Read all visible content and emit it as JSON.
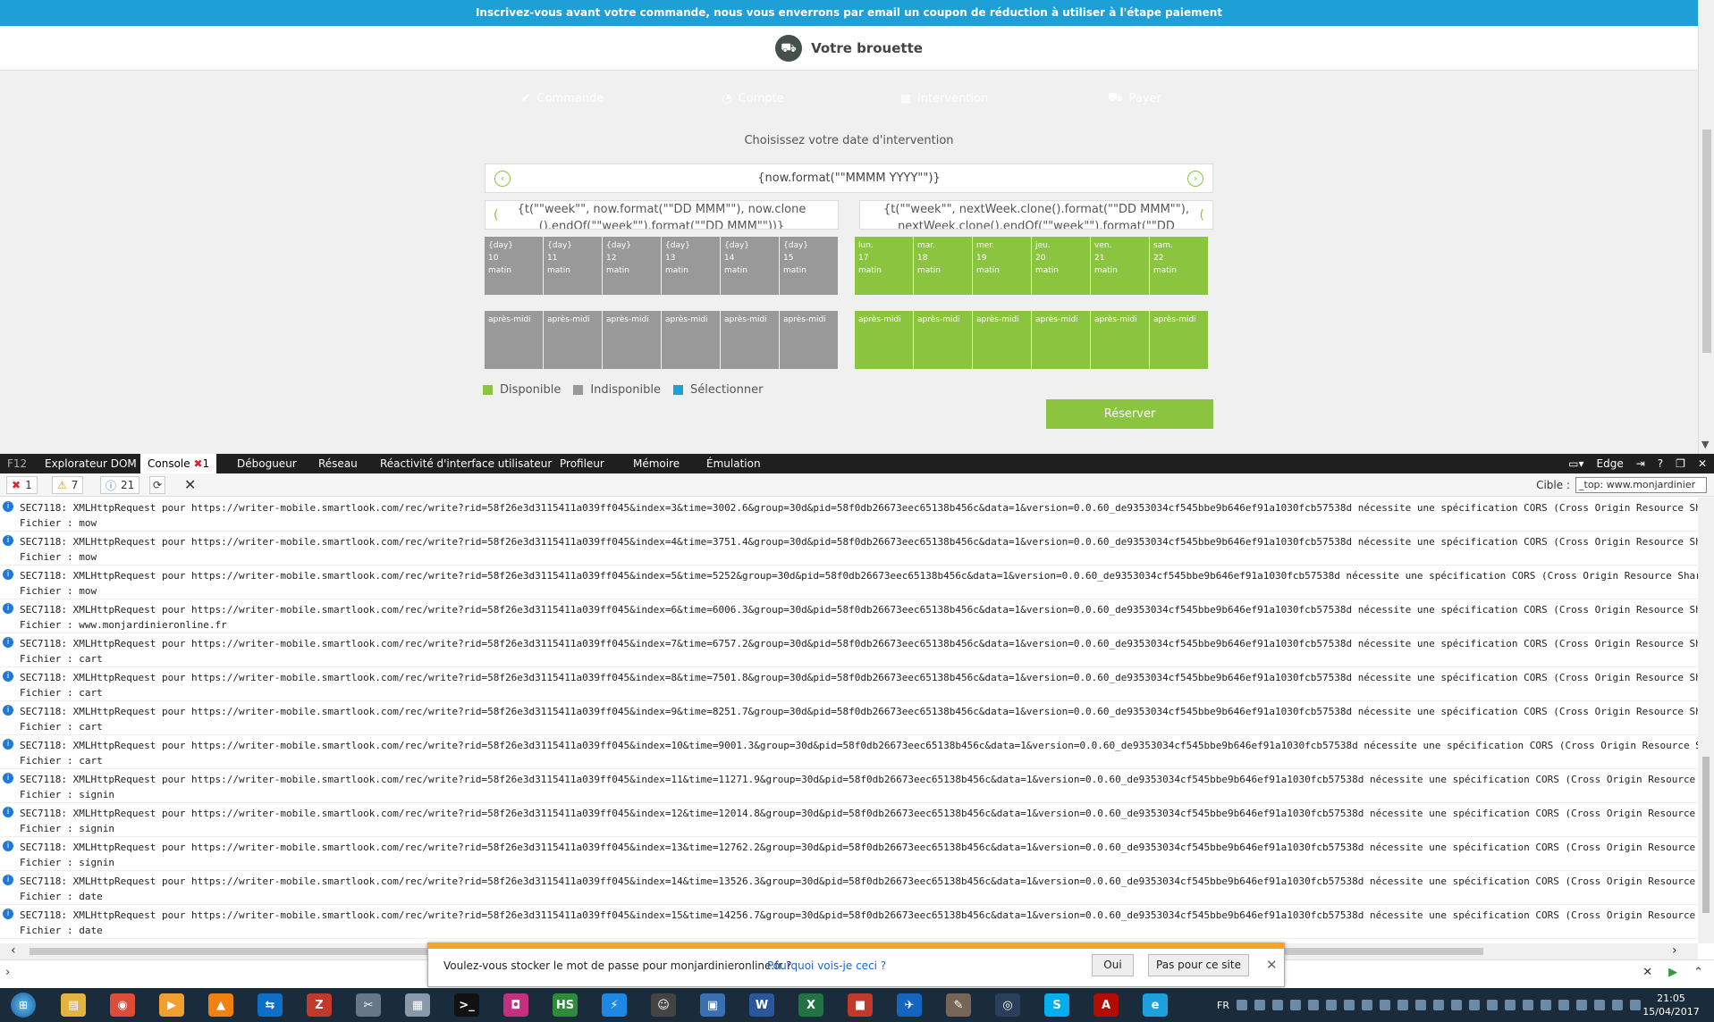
{
  "banner": {
    "text": "Inscrivez-vous avant votre commande, nous vous enverrons par email un coupon de réduction à utiliser à l'étape paiement"
  },
  "header": {
    "title": "Votre brouette"
  },
  "steps": [
    {
      "label": "Commande",
      "icon": "check-icon",
      "glyph": "✔",
      "state": "done"
    },
    {
      "label": "Compte",
      "icon": "user-icon",
      "glyph": "◔",
      "state": "done"
    },
    {
      "label": "Intervention",
      "icon": "calendar-icon",
      "glyph": "▦",
      "state": "done"
    },
    {
      "label": "Payer",
      "icon": "cart-icon",
      "glyph": "⛟",
      "state": "active"
    }
  ],
  "calendar": {
    "title": "Choisissez votre date d'intervention",
    "month_label": "{now.format(\"\"MMMM YYYY\"\")}",
    "week1": {
      "label": "{t(\"\"week\"\", now.format(\"\"DD MMM\"\"), now.clone ().endOf(\"\"week\"\").format(\"\"DD MMM\"\"))}"
    },
    "week2": {
      "label": "{t(\"\"week\"\", nextWeek.clone().format(\"\"DD MMM\"\"), nextWeek.clone().endOf(\"\"week\"\").format(\"\"DD MMM\"\"))}"
    },
    "week1_days": [
      {
        "name": "{day}",
        "num": "10",
        "morning": "matin",
        "afternoon": "après-midi"
      },
      {
        "name": "{day}",
        "num": "11",
        "morning": "matin",
        "afternoon": "après-midi"
      },
      {
        "name": "{day}",
        "num": "12",
        "morning": "matin",
        "afternoon": "après-midi"
      },
      {
        "name": "{day}",
        "num": "13",
        "morning": "matin",
        "afternoon": "après-midi"
      },
      {
        "name": "{day}",
        "num": "14",
        "morning": "matin",
        "afternoon": "après-midi"
      },
      {
        "name": "{day}",
        "num": "15",
        "morning": "matin",
        "afternoon": "après-midi"
      }
    ],
    "week2_days": [
      {
        "name": "lun.",
        "num": "17",
        "morning": "matin",
        "afternoon": "après-midi"
      },
      {
        "name": "mar.",
        "num": "18",
        "morning": "matin",
        "afternoon": "après-midi"
      },
      {
        "name": "mer.",
        "num": "19",
        "morning": "matin",
        "afternoon": "après-midi"
      },
      {
        "name": "jeu.",
        "num": "20",
        "morning": "matin",
        "afternoon": "après-midi"
      },
      {
        "name": "ven.",
        "num": "21",
        "morning": "matin",
        "afternoon": "après-midi"
      },
      {
        "name": "sam.",
        "num": "22",
        "morning": "matin",
        "afternoon": "après-midi"
      }
    ],
    "legend": [
      {
        "label": "Disponible",
        "color": "#8bc540"
      },
      {
        "label": "Indisponible",
        "color": "#999999"
      },
      {
        "label": "Sélectionner",
        "color": "#1e9fd6"
      }
    ],
    "reserve_label": "Réserver"
  },
  "devtools": {
    "tabs": [
      {
        "label": "F12",
        "active": false
      },
      {
        "label": "Explorateur DOM",
        "active": false
      },
      {
        "label": "Console",
        "active": true,
        "badge": "1"
      },
      {
        "label": "Débogueur",
        "active": false
      },
      {
        "label": "Réseau",
        "active": false
      },
      {
        "label": "Réactivité d'interface utilisateur",
        "active": false
      },
      {
        "label": "Profileur",
        "active": false
      },
      {
        "label": "Mémoire",
        "active": false
      },
      {
        "label": "Émulation",
        "active": false
      }
    ],
    "mode_label": "Edge",
    "counts": {
      "errors": "1",
      "warnings": "7",
      "info": "21"
    },
    "target_label": "Cible :",
    "target_value": "_top: www.monjardinier",
    "logs": [
      {
        "msg": "SEC7118: XMLHttpRequest pour https://writer-mobile.smartlook.com/rec/write?rid=58f26e3d3115411a039ff045&index=3&time=3002.6&group=30d&pid=58f0db26673eec65138b456c&data=1&version=0.0.60_de9353034cf545bbe9b646ef91a1030fcb57538d nécessite une spécification CORS (Cross Origin Resource Sha",
        "file": "Fichier : mow"
      },
      {
        "msg": "SEC7118: XMLHttpRequest pour https://writer-mobile.smartlook.com/rec/write?rid=58f26e3d3115411a039ff045&index=4&time=3751.4&group=30d&pid=58f0db26673eec65138b456c&data=1&version=0.0.60_de9353034cf545bbe9b646ef91a1030fcb57538d nécessite une spécification CORS (Cross Origin Resource Sha",
        "file": "Fichier : mow"
      },
      {
        "msg": "SEC7118: XMLHttpRequest pour https://writer-mobile.smartlook.com/rec/write?rid=58f26e3d3115411a039ff045&index=5&time=5252&group=30d&pid=58f0db26673eec65138b456c&data=1&version=0.0.60_de9353034cf545bbe9b646ef91a1030fcb57538d nécessite une spécification CORS (Cross Origin Resource Shar",
        "file": "Fichier : mow"
      },
      {
        "msg": "SEC7118: XMLHttpRequest pour https://writer-mobile.smartlook.com/rec/write?rid=58f26e3d3115411a039ff045&index=6&time=6006.3&group=30d&pid=58f0db26673eec65138b456c&data=1&version=0.0.60_de9353034cf545bbe9b646ef91a1030fcb57538d nécessite une spécification CORS (Cross Origin Resource Sha",
        "file": "Fichier : www.monjardinieronline.fr"
      },
      {
        "msg": "SEC7118: XMLHttpRequest pour https://writer-mobile.smartlook.com/rec/write?rid=58f26e3d3115411a039ff045&index=7&time=6757.2&group=30d&pid=58f0db26673eec65138b456c&data=1&version=0.0.60_de9353034cf545bbe9b646ef91a1030fcb57538d nécessite une spécification CORS (Cross Origin Resource Sha",
        "file": "Fichier : cart"
      },
      {
        "msg": "SEC7118: XMLHttpRequest pour https://writer-mobile.smartlook.com/rec/write?rid=58f26e3d3115411a039ff045&index=8&time=7501.8&group=30d&pid=58f0db26673eec65138b456c&data=1&version=0.0.60_de9353034cf545bbe9b646ef91a1030fcb57538d nécessite une spécification CORS (Cross Origin Resource Sha",
        "file": "Fichier : cart"
      },
      {
        "msg": "SEC7118: XMLHttpRequest pour https://writer-mobile.smartlook.com/rec/write?rid=58f26e3d3115411a039ff045&index=9&time=8251.7&group=30d&pid=58f0db26673eec65138b456c&data=1&version=0.0.60_de9353034cf545bbe9b646ef91a1030fcb57538d nécessite une spécification CORS (Cross Origin Resource Sha",
        "file": "Fichier : cart"
      },
      {
        "msg": "SEC7118: XMLHttpRequest pour https://writer-mobile.smartlook.com/rec/write?rid=58f26e3d3115411a039ff045&index=10&time=9001.3&group=30d&pid=58f0db26673eec65138b456c&data=1&version=0.0.60_de9353034cf545bbe9b646ef91a1030fcb57538d nécessite une spécification CORS (Cross Origin Resource S",
        "file": "Fichier : cart"
      },
      {
        "msg": "SEC7118: XMLHttpRequest pour https://writer-mobile.smartlook.com/rec/write?rid=58f26e3d3115411a039ff045&index=11&time=11271.9&group=30d&pid=58f0db26673eec65138b456c&data=1&version=0.0.60_de9353034cf545bbe9b646ef91a1030fcb57538d nécessite une spécification CORS (Cross Origin Resource",
        "file": "Fichier : signin"
      },
      {
        "msg": "SEC7118: XMLHttpRequest pour https://writer-mobile.smartlook.com/rec/write?rid=58f26e3d3115411a039ff045&index=12&time=12014.8&group=30d&pid=58f0db26673eec65138b456c&data=1&version=0.0.60_de9353034cf545bbe9b646ef91a1030fcb57538d nécessite une spécification CORS (Cross Origin Resource",
        "file": "Fichier : signin"
      },
      {
        "msg": "SEC7118: XMLHttpRequest pour https://writer-mobile.smartlook.com/rec/write?rid=58f26e3d3115411a039ff045&index=13&time=12762.2&group=30d&pid=58f0db26673eec65138b456c&data=1&version=0.0.60_de9353034cf545bbe9b646ef91a1030fcb57538d nécessite une spécification CORS (Cross Origin Resource",
        "file": "Fichier : signin"
      },
      {
        "msg": "SEC7118: XMLHttpRequest pour https://writer-mobile.smartlook.com/rec/write?rid=58f26e3d3115411a039ff045&index=14&time=13526.3&group=30d&pid=58f0db26673eec65138b456c&data=1&version=0.0.60_de9353034cf545bbe9b646ef91a1030fcb57538d nécessite une spécification CORS (Cross Origin Resource S",
        "file": "Fichier : date"
      },
      {
        "msg": "SEC7118: XMLHttpRequest pour https://writer-mobile.smartlook.com/rec/write?rid=58f26e3d3115411a039ff045&index=15&time=14256.7&group=30d&pid=58f0db26673eec65138b456c&data=1&version=0.0.60_de9353034cf545bbe9b646ef91a1030fcb57538d nécessite une spécification CORS (Cross Origin Resource S",
        "file": "Fichier : date"
      }
    ]
  },
  "password_prompt": {
    "question": "Voulez-vous stocker le mot de passe pour monjardinieronline.fr ?",
    "why_link": "Pourquoi vois-je ceci ?",
    "yes_label": "Oui",
    "no_label": "Pas pour ce site"
  },
  "taskbar": {
    "apps": [
      {
        "name": "explorer-icon",
        "color": "#e3b341",
        "glyph": "▤"
      },
      {
        "name": "chrome-icon",
        "color": "#dd4b39",
        "glyph": "◉"
      },
      {
        "name": "media-player-icon",
        "color": "#f0a030",
        "glyph": "▶"
      },
      {
        "name": "vlc-icon",
        "color": "#f08010",
        "glyph": "▲"
      },
      {
        "name": "teamviewer-icon",
        "color": "#0e6fc7",
        "glyph": "⇆"
      },
      {
        "name": "filezilla-icon",
        "color": "#c0392b",
        "glyph": "Z"
      },
      {
        "name": "tools-icon",
        "color": "#667788",
        "glyph": "✂"
      },
      {
        "name": "calculator-icon",
        "color": "#8899aa",
        "glyph": "▦"
      },
      {
        "name": "cmd-icon",
        "color": "#111111",
        "glyph": ">_"
      },
      {
        "name": "app-pink-icon",
        "color": "#c42f80",
        "glyph": "◘"
      },
      {
        "name": "hs-icon",
        "color": "#2e8b3a",
        "glyph": "HS"
      },
      {
        "name": "thunderbolt-icon",
        "color": "#1e88e5",
        "glyph": "⚡"
      },
      {
        "name": "smiley-icon",
        "color": "#444444",
        "glyph": "☺"
      },
      {
        "name": "remote-desktop-icon",
        "color": "#3a6fb0",
        "glyph": "▣"
      },
      {
        "name": "word-icon",
        "color": "#2b579a",
        "glyph": "W"
      },
      {
        "name": "excel-icon",
        "color": "#217346",
        "glyph": "X"
      },
      {
        "name": "package-icon",
        "color": "#c0392b",
        "glyph": "■"
      },
      {
        "name": "app-blue-icon",
        "color": "#1565c0",
        "glyph": "✈"
      },
      {
        "name": "gimp-icon",
        "color": "#776655",
        "glyph": "✎"
      },
      {
        "name": "steam-icon",
        "color": "#2a3f5a",
        "glyph": "◎"
      },
      {
        "name": "skype-icon",
        "color": "#00aff0",
        "glyph": "S"
      },
      {
        "name": "acrobat-icon",
        "color": "#b30b00",
        "glyph": "A"
      },
      {
        "name": "ie-icon",
        "color": "#1ea0e0",
        "glyph": "e"
      }
    ],
    "lang": "FR",
    "time": "21:05",
    "date": "15/04/2017"
  }
}
